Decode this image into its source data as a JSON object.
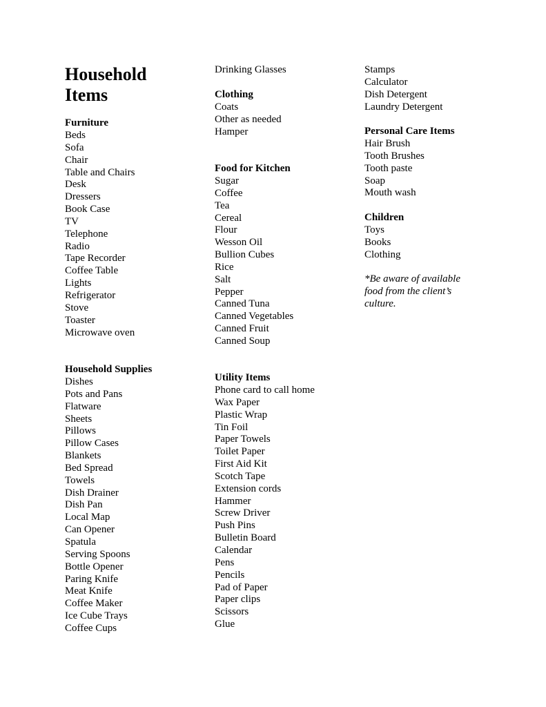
{
  "document": {
    "title_line1": "Household",
    "title_line2": "Items",
    "sections": {
      "furniture": {
        "heading": "Furniture",
        "items": [
          "Beds",
          "Sofa",
          "Chair",
          "Table and Chairs",
          "Desk",
          "Dressers",
          "Book Case",
          "TV",
          "Telephone",
          "Radio",
          "Tape Recorder",
          "Coffee Table",
          "Lights",
          "Refrigerator",
          "Stove",
          "Toaster",
          "Microwave oven"
        ]
      },
      "household_supplies": {
        "heading": "Household Supplies",
        "items": [
          "Dishes",
          "Pots and Pans",
          "Flatware",
          "Sheets",
          "Pillows",
          "Pillow Cases",
          "Blankets",
          "Bed Spread",
          "Towels",
          "Dish Drainer",
          "Dish Pan",
          "Local Map",
          "Can Opener",
          "Spatula",
          "Serving Spoons",
          "Bottle Opener",
          "Paring Knife",
          "Meat Knife",
          "Coffee Maker",
          "Ice Cube Trays",
          "Coffee Cups",
          "Drinking Glasses"
        ]
      },
      "clothing": {
        "heading": "Clothing",
        "items": [
          "Coats",
          "Other as needed",
          "Hamper"
        ]
      },
      "food_for_kitchen": {
        "heading": "Food for Kitchen",
        "items": [
          "Sugar",
          "Coffee",
          "Tea",
          "Cereal",
          "Flour",
          "Wesson Oil",
          "Bullion Cubes",
          "Rice",
          "Salt",
          "Pepper",
          "Canned Tuna",
          "Canned Vegetables",
          "Canned Fruit",
          "Canned Soup"
        ]
      },
      "utility_items": {
        "heading": "Utility Items",
        "items": [
          "Phone card to call home",
          "Wax Paper",
          "Plastic Wrap",
          "Tin Foil",
          "Paper Towels",
          "Toilet Paper",
          "First Aid Kit",
          "Scotch Tape",
          "Extension cords",
          "Hammer",
          "Screw Driver",
          "Push Pins",
          "Bulletin Board",
          "Calendar",
          "Pens",
          "Pencils",
          "Pad of Paper",
          "Paper clips",
          "Scissors",
          "Glue",
          "Stamps",
          "Calculator",
          "Dish Detergent",
          "Laundry Detergent"
        ]
      },
      "personal_care_items": {
        "heading": "Personal Care Items",
        "items": [
          "Hair Brush",
          "Tooth Brushes",
          "Tooth paste",
          "Soap",
          "Mouth wash"
        ]
      },
      "children": {
        "heading": "Children",
        "items": [
          "Toys",
          "Books",
          "Clothing"
        ]
      }
    },
    "note_lines": [
      "*Be aware of available",
      "food from the client’s",
      "culture."
    ]
  }
}
